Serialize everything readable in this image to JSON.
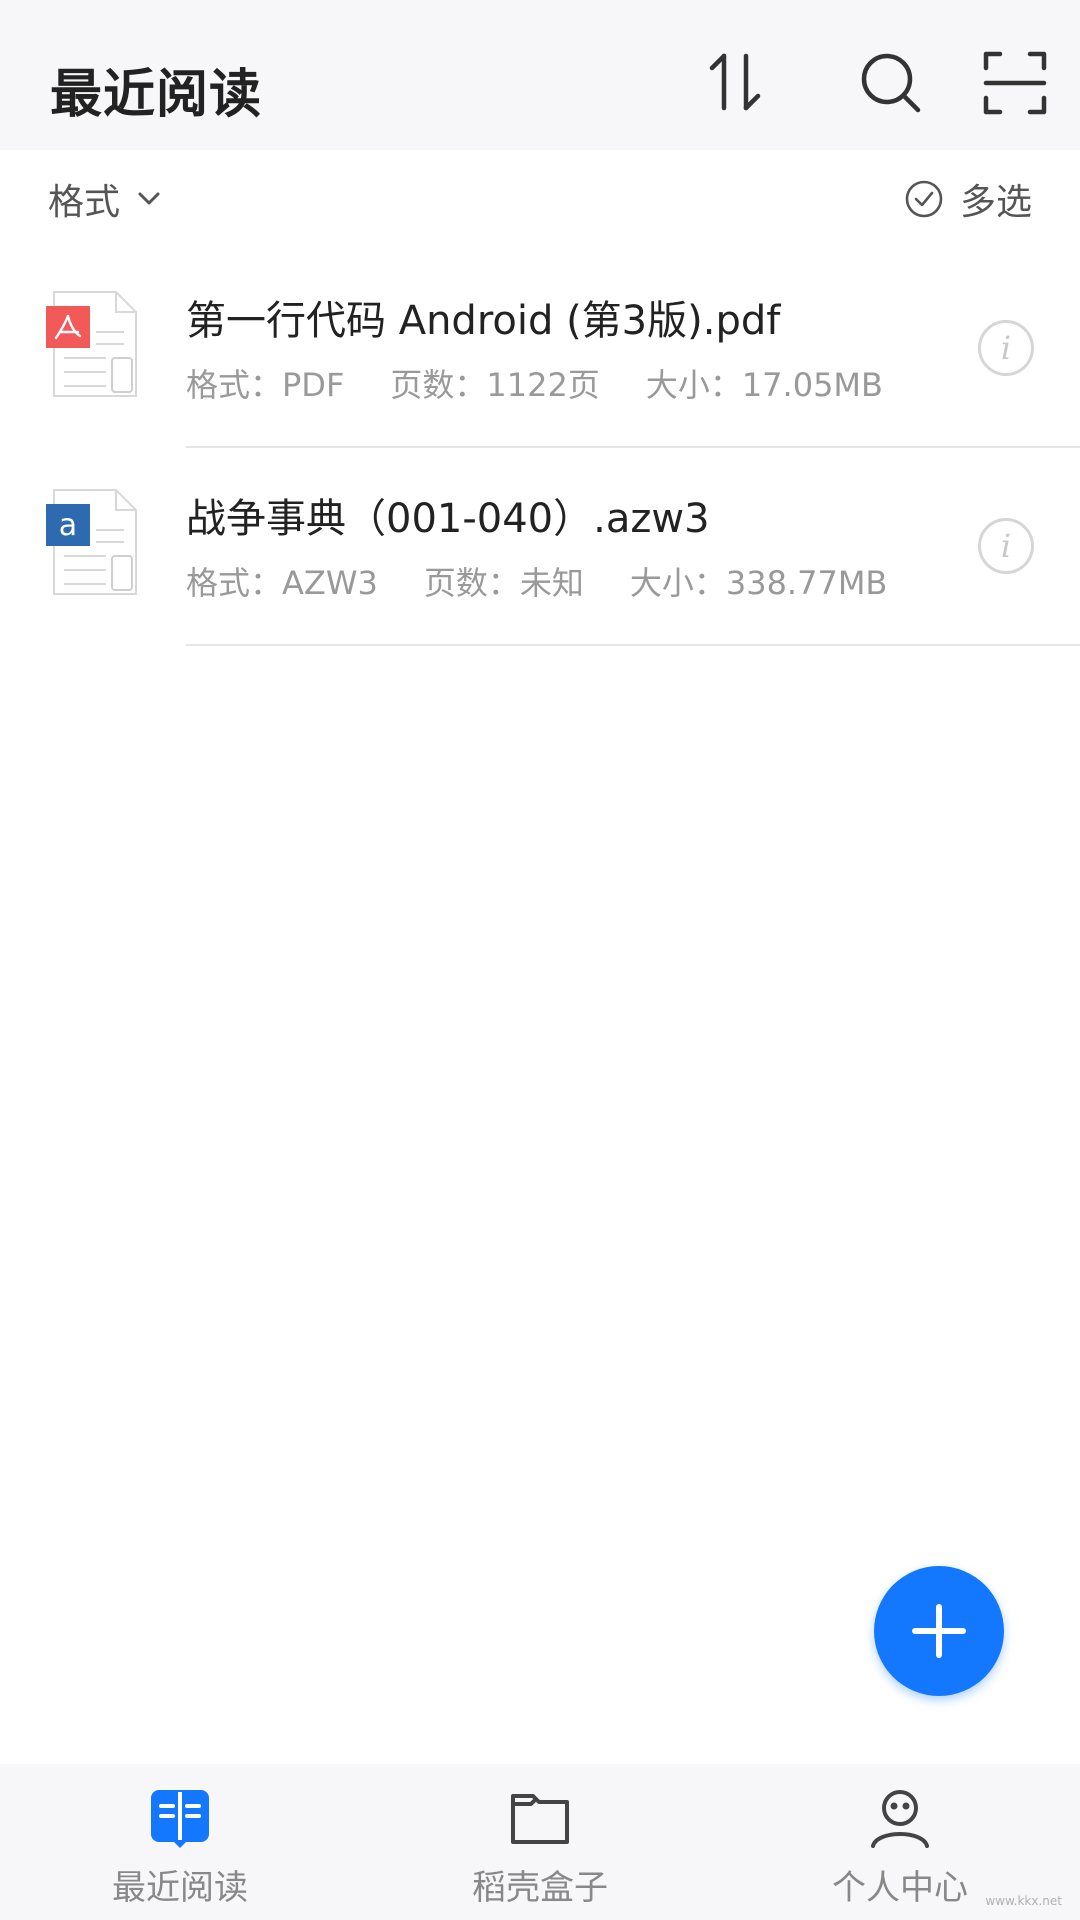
{
  "header": {
    "title": "最近阅读",
    "icons": [
      "sort-icon",
      "search-icon",
      "scan-icon"
    ]
  },
  "filter": {
    "format_label": "格式",
    "multi_select_label": "多选"
  },
  "files": [
    {
      "type_icon": "pdf-file-icon",
      "name": "第一行代码 Android (第3版).pdf",
      "format": "格式：PDF",
      "pages": "页数：1122页",
      "size": "大小：17.05MB"
    },
    {
      "type_icon": "azw3-file-icon",
      "name": "战争事典（001-040）.azw3",
      "format": "格式：AZW3",
      "pages": "页数：未知",
      "size": "大小：338.77MB"
    }
  ],
  "fab": {
    "icon": "plus-icon"
  },
  "nav": [
    {
      "label": "最近阅读",
      "icon": "book-open-icon",
      "active": true
    },
    {
      "label": "稻壳盒子",
      "icon": "folder-icon",
      "active": false
    },
    {
      "label": "个人中心",
      "icon": "user-icon",
      "active": false
    }
  ],
  "colors": {
    "accent": "#1478ff",
    "pdf_red": "#f25a5a",
    "azw_blue": "#2d6ab0",
    "header_bg": "#f7f7f9"
  },
  "watermark": "www.kkx.net"
}
